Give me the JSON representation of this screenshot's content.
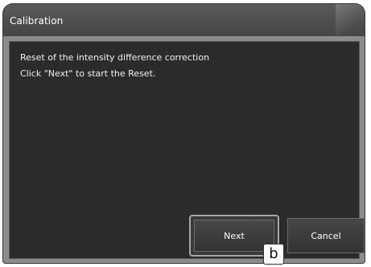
{
  "dialog": {
    "title": "Calibration",
    "message_line1": "Reset of the intensity difference correction",
    "message_line2": "Click \"Next\" to start the Reset."
  },
  "buttons": {
    "next_label": "Next",
    "cancel_label": "Cancel"
  },
  "annotation": {
    "callout_label": "b"
  }
}
